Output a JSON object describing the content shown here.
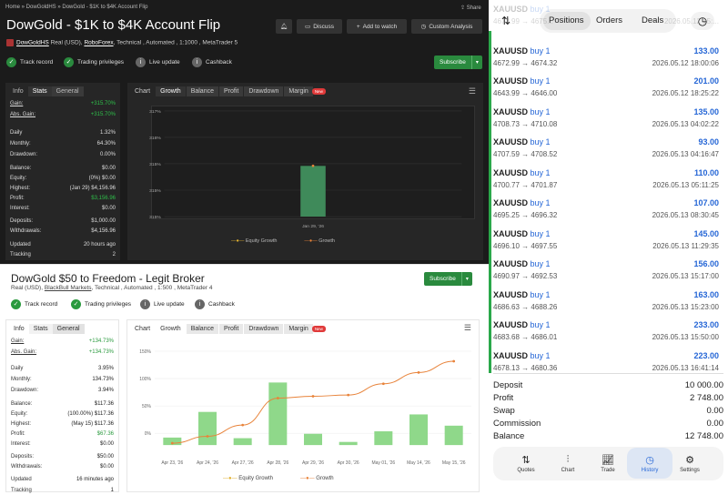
{
  "dark_panel": {
    "breadcrumb": "Home » DowGoldHS » DowGold - $1K to $4K Account Flip",
    "share": "Share",
    "title": "DowGold - $1K to $4K Account Flip",
    "user": "DowGoldHS",
    "broker": "RoboForex",
    "details_prefix": "Real (USD),",
    "details_suffix": ", Technical , Automated , 1:1000 , MetaTrader 5",
    "discuss": "Discuss",
    "add_watch": "Add to watch",
    "custom_analysis": "Custom Analysis",
    "badges": [
      "Track record",
      "Trading privileges",
      "Live update",
      "Cashback"
    ],
    "subscribe": "Subscribe",
    "stats_tabs": [
      "Info",
      "Stats",
      "General"
    ],
    "stats": [
      {
        "label": "Gain:",
        "value": "+315.70%",
        "color": "#2fbf4a"
      },
      {
        "label": "Abs. Gain:",
        "value": "+315.70%",
        "color": "#2fbf4a"
      },
      {
        "label": "Daily",
        "value": "1.32%",
        "color": "#ddd"
      },
      {
        "label": "Monthly:",
        "value": "64.30%",
        "color": "#ddd"
      },
      {
        "label": "Drawdown:",
        "value": "0.00%",
        "color": "#ddd"
      },
      {
        "label": "Balance:",
        "value": "$0.00",
        "color": "#ddd"
      },
      {
        "label": "Equity:",
        "value": "(0%) $0.00",
        "color": "#ddd"
      },
      {
        "label": "Highest:",
        "value": "(Jan 29) $4,156.96",
        "color": "#ddd"
      },
      {
        "label": "Profit:",
        "value": "$3,156.96",
        "color": "#2fbf4a"
      },
      {
        "label": "Interest:",
        "value": "$0.00",
        "color": "#ddd"
      },
      {
        "label": "Deposits:",
        "value": "$1,000.00",
        "color": "#ddd"
      },
      {
        "label": "Withdrawals:",
        "value": "$4,156.96",
        "color": "#ddd"
      },
      {
        "label": "Updated",
        "value": "20 hours ago",
        "color": "#ddd"
      },
      {
        "label": "Tracking",
        "value": "2",
        "color": "#ddd"
      }
    ],
    "chart_tabs": [
      "Chart",
      "Growth",
      "Balance",
      "Profit",
      "Drawdown",
      "Margin"
    ],
    "new_badge": "New",
    "legend": [
      "Equity Growth",
      "Growth"
    ]
  },
  "light_panel": {
    "title": "DowGold $50 to Freedom - Legit Broker",
    "details_prefix": "Real (USD),",
    "broker": "BlackBull Markets",
    "details_suffix": ", Technical , Automated , 1:500 , MetaTrader 4",
    "subscribe": "Subscribe",
    "badges": [
      "Track record",
      "Trading privileges",
      "Live update",
      "Cashback"
    ],
    "stats_tabs": [
      "Info",
      "Stats",
      "General"
    ],
    "stats": [
      {
        "label": "Gain:",
        "value": "+134.73%",
        "color": "#2a9a3e"
      },
      {
        "label": "Abs. Gain:",
        "value": "+134.73%",
        "color": "#2a9a3e"
      },
      {
        "label": "Daily",
        "value": "3.95%",
        "color": "#222"
      },
      {
        "label": "Monthly:",
        "value": "134.73%",
        "color": "#222"
      },
      {
        "label": "Drawdown:",
        "value": "3.94%",
        "color": "#222"
      },
      {
        "label": "Balance:",
        "value": "$117.36",
        "color": "#222"
      },
      {
        "label": "Equity:",
        "value": "(100.00%) $117.36",
        "color": "#222"
      },
      {
        "label": "Highest:",
        "value": "(May 15) $117.36",
        "color": "#222"
      },
      {
        "label": "Profit:",
        "value": "$67.36",
        "color": "#2a9a3e"
      },
      {
        "label": "Interest:",
        "value": "$0.00",
        "color": "#222"
      },
      {
        "label": "Deposits:",
        "value": "$50.00",
        "color": "#222"
      },
      {
        "label": "Withdrawals:",
        "value": "$0.00",
        "color": "#222"
      },
      {
        "label": "Updated",
        "value": "16 minutes ago",
        "color": "#222"
      },
      {
        "label": "Tracking",
        "value": "1",
        "color": "#222"
      }
    ],
    "chart_tabs": [
      "Chart",
      "Growth",
      "Balance",
      "Profit",
      "Drawdown",
      "Margin"
    ],
    "new_badge": "New",
    "legend": [
      "Equity Growth",
      "Growth"
    ]
  },
  "chart_data": [
    {
      "type": "bar",
      "categories": [
        "Jan 29, '26"
      ],
      "values": [
        315.7
      ],
      "y_ticks": [
        "317%",
        "316%",
        "315%",
        "315%",
        "315%"
      ],
      "ylim": [
        314.5,
        317
      ],
      "line_series": [
        {
          "name": "Growth",
          "values": [
            315.7
          ]
        }
      ],
      "legend": [
        "Equity Growth",
        "Growth"
      ],
      "colors": {
        "bar": "#3f8a5a",
        "line": "#e8833a"
      }
    },
    {
      "type": "bar",
      "categories": [
        "Apr 23, '26",
        "Apr 24, '26",
        "Apr 27, '26",
        "Apr 28, '26",
        "Apr 29, '26",
        "Apr 30, '26",
        "May 01, '26",
        "May 14, '26",
        "May 15, '26"
      ],
      "values": [
        12,
        53,
        11,
        100,
        18,
        5,
        22,
        49,
        31
      ],
      "y_ticks": [
        "150%",
        "100%",
        "50%",
        "0%"
      ],
      "ylim": [
        -10,
        150
      ],
      "line_series": [
        {
          "name": "Growth",
          "values": [
            3,
            14,
            32,
            75,
            78,
            80,
            98,
            116,
            134
          ]
        }
      ],
      "legend": [
        "Equity Growth",
        "Growth"
      ],
      "colors": {
        "bar": "#8fd88a",
        "line": "#e8833a"
      }
    }
  ],
  "mobile": {
    "tabs": [
      "Positions",
      "Orders",
      "Deals"
    ],
    "trades": [
      {
        "symbol": "XAUUSD",
        "side": "buy 1",
        "profit": "",
        "prices": "4672.99 → 4675...",
        "date": "2026.05.12 15:...",
        "partial": true
      },
      {
        "symbol": "XAUUSD",
        "side": "buy 1",
        "profit": "133.00",
        "prices": "4672.99 → 4674.32",
        "date": "2026.05.12 18:00:06"
      },
      {
        "symbol": "XAUUSD",
        "side": "buy 1",
        "profit": "201.00",
        "prices": "4643.99 → 4646.00",
        "date": "2026.05.12 18:25:22"
      },
      {
        "symbol": "XAUUSD",
        "side": "buy 1",
        "profit": "135.00",
        "prices": "4708.73 → 4710.08",
        "date": "2026.05.13 04:02:22"
      },
      {
        "symbol": "XAUUSD",
        "side": "buy 1",
        "profit": "93.00",
        "prices": "4707.59 → 4708.52",
        "date": "2026.05.13 04:16:47"
      },
      {
        "symbol": "XAUUSD",
        "side": "buy 1",
        "profit": "110.00",
        "prices": "4700.77 → 4701.87",
        "date": "2026.05.13 05:11:25"
      },
      {
        "symbol": "XAUUSD",
        "side": "buy 1",
        "profit": "107.00",
        "prices": "4695.25 → 4696.32",
        "date": "2026.05.13 08:30:45"
      },
      {
        "symbol": "XAUUSD",
        "side": "buy 1",
        "profit": "145.00",
        "prices": "4696.10 → 4697.55",
        "date": "2026.05.13 11:29:35"
      },
      {
        "symbol": "XAUUSD",
        "side": "buy 1",
        "profit": "156.00",
        "prices": "4690.97 → 4692.53",
        "date": "2026.05.13 15:17:00"
      },
      {
        "symbol": "XAUUSD",
        "side": "buy 1",
        "profit": "163.00",
        "prices": "4686.63 → 4688.26",
        "date": "2026.05.13 15:23:00"
      },
      {
        "symbol": "XAUUSD",
        "side": "buy 1",
        "profit": "233.00",
        "prices": "4683.68 → 4686.01",
        "date": "2026.05.13 15:50:00"
      },
      {
        "symbol": "XAUUSD",
        "side": "buy 1",
        "profit": "223.00",
        "prices": "4678.13 → 4680.36",
        "date": "2026.05.13 16:41:14"
      }
    ],
    "summary": [
      {
        "label": "Deposit",
        "value": "10 000.00"
      },
      {
        "label": "Profit",
        "value": "2 748.00"
      },
      {
        "label": "Swap",
        "value": "0.00"
      },
      {
        "label": "Commission",
        "value": "0.00"
      },
      {
        "label": "Balance",
        "value": "12 748.00"
      }
    ],
    "nav": [
      "Quotes",
      "Chart",
      "Trade",
      "History",
      "Settings"
    ],
    "active_nav": "History"
  }
}
